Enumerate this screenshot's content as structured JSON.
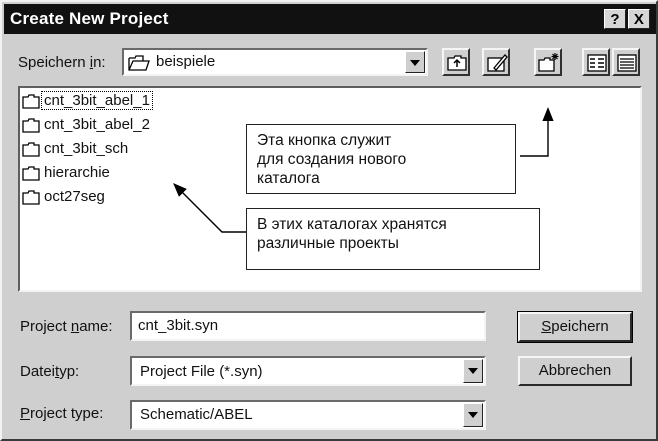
{
  "title": "Create New Project",
  "title_buttons": [
    "?",
    "X"
  ],
  "location": {
    "label_pre": "Speichern ",
    "label_key": "i",
    "label_post": "n:",
    "value": "beispiele"
  },
  "toolbar": {
    "icons": [
      "up-folder-icon",
      "edit-folder-icon",
      "new-folder-icon",
      "list-view-icon",
      "details-view-icon"
    ]
  },
  "folders": [
    "cnt_3bit_abel_1",
    "cnt_3bit_abel_2",
    "cnt_3bit_sch",
    "hierarchie",
    "oct27seg"
  ],
  "callouts": {
    "new_folder": [
      "Эта кнопка служит",
      "для создания нового",
      "каталога"
    ],
    "folders": [
      "В этих каталогах хранятся",
      "различные проекты"
    ]
  },
  "form": {
    "name_label_pre": "Project ",
    "name_label_key": "n",
    "name_label_post": "ame:",
    "name_value": "cnt_3bit.syn",
    "filetype_label_pre": "Datei",
    "filetype_label_key": "t",
    "filetype_label_post": "yp:",
    "filetype_value": "Project File (*.syn)",
    "ptype_label_key": "P",
    "ptype_label_post": "roject type:",
    "ptype_value": "Schematic/ABEL"
  },
  "buttons": {
    "save_key": "S",
    "save_rest": "peichern",
    "cancel": "Abbrechen"
  }
}
